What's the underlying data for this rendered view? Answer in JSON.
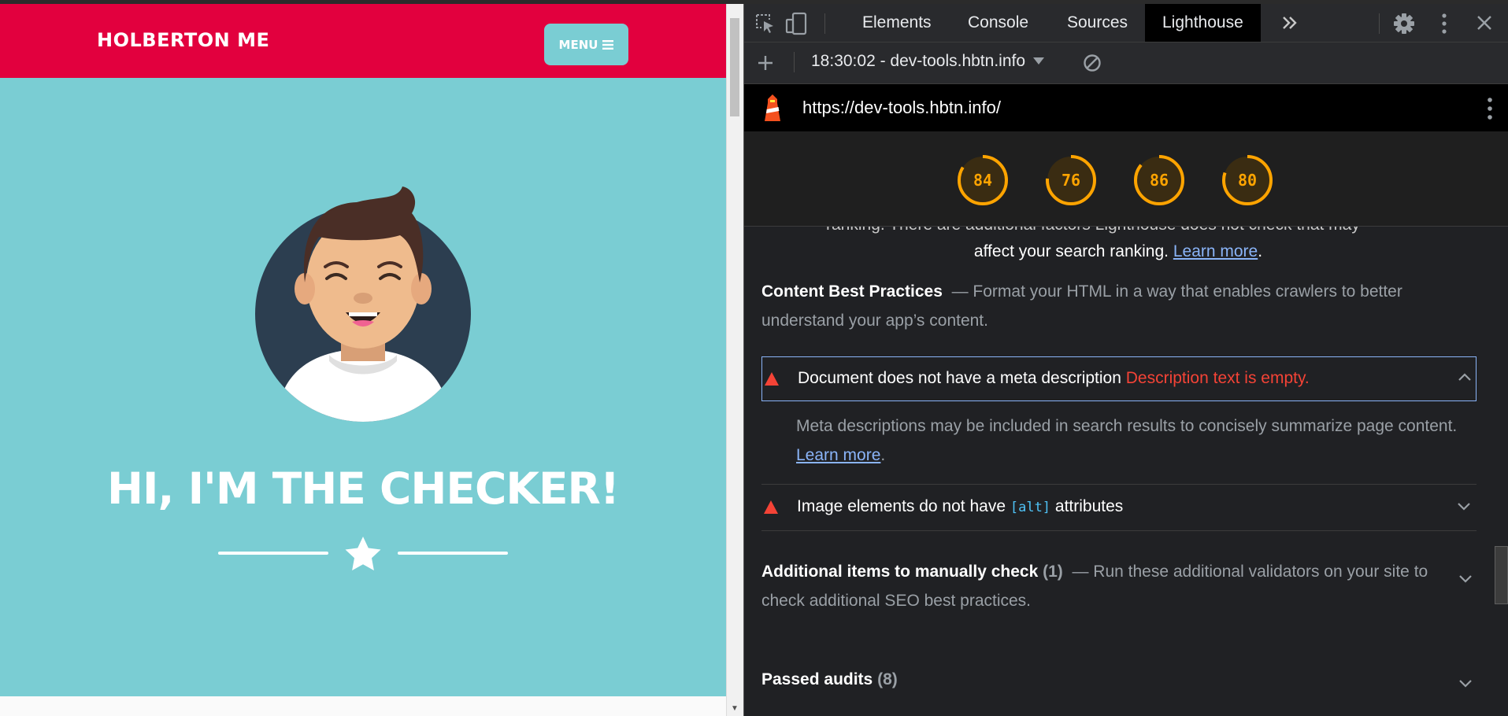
{
  "website": {
    "brand": "HOLBERTON ME",
    "menu_label": "MENU",
    "hero_title": "HI, I'M THE CHECKER!",
    "colors": {
      "nav_bg": "#e2003e",
      "hero_bg": "#7acdd3",
      "menu_button_bg": "#7acdd3"
    }
  },
  "devtools": {
    "tabs": [
      "Elements",
      "Console",
      "Sources",
      "Lighthouse"
    ],
    "active_tab": "Lighthouse",
    "toolbar": {
      "report_label": "18:30:02 - dev-tools.hbtn.info"
    },
    "url": "https://dev-tools.hbtn.info/",
    "scores": [
      84,
      76,
      86,
      80
    ],
    "score_color": "#ffa400",
    "report": {
      "cutoff_text": "ranking. There are additional factors Lighthouse does not check that may",
      "seo_line_text": "affect your search ranking.",
      "seo_line_link": "Learn more",
      "content_group": {
        "title": "Content Best Practices",
        "description": "Format your HTML in a way that enables crawlers to better understand your app’s content."
      },
      "audits": [
        {
          "title": "Document does not have a meta description",
          "error": "Description text is empty.",
          "description": "Meta descriptions may be included in search results to concisely summarize page content.",
          "link": "Learn more",
          "expanded": true
        },
        {
          "title_prefix": "Image elements do not have",
          "code": "[alt]",
          "title_suffix": "attributes",
          "expanded": false
        }
      ],
      "manual_group": {
        "title": "Additional items to manually check",
        "count": "(1)",
        "description": "Run these additional validators on your site to check additional SEO best practices."
      },
      "passed_group": {
        "title": "Passed audits",
        "count": "(8)"
      }
    }
  }
}
